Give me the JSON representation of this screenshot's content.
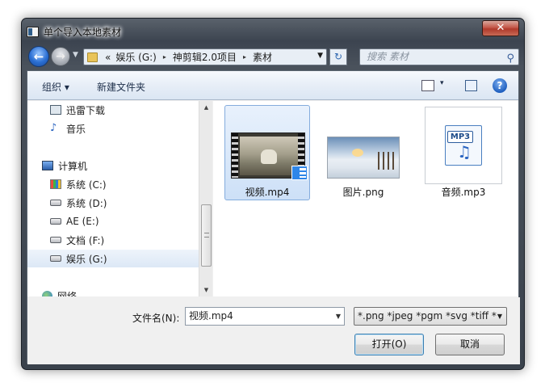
{
  "window": {
    "title": "单个导入本地素材",
    "close_label": "✕"
  },
  "address": {
    "overflow": "«",
    "breadcrumbs": [
      "娱乐 (G:)",
      "神剪辑2.0项目",
      "素材"
    ],
    "separator": "▸",
    "search_placeholder": "搜索 素材"
  },
  "toolbar": {
    "organize": "组织 ▾",
    "new_folder": "新建文件夹",
    "view_dropdown": "▾",
    "help": "?"
  },
  "nav": {
    "items": [
      {
        "label": "迅雷下载",
        "icon": "download-folder-icon"
      },
      {
        "label": "音乐",
        "icon": "music-icon"
      },
      {
        "label": "计算机",
        "icon": "computer-icon"
      },
      {
        "label": "系统 (C:)",
        "icon": "system-drive-icon"
      },
      {
        "label": "系统 (D:)",
        "icon": "drive-icon"
      },
      {
        "label": "AE (E:)",
        "icon": "drive-icon"
      },
      {
        "label": "文档 (F:)",
        "icon": "drive-icon"
      },
      {
        "label": "娱乐 (G:)",
        "icon": "drive-icon",
        "selected": true
      },
      {
        "label": "网络",
        "icon": "network-icon"
      }
    ]
  },
  "files": [
    {
      "name": "视频.mp4",
      "type": "video",
      "selected": true
    },
    {
      "name": "图片.png",
      "type": "image"
    },
    {
      "name": "音频.mp3",
      "type": "audio",
      "badge": "MP3",
      "note": "♫"
    }
  ],
  "footer": {
    "filename_label": "文件名(N):",
    "filename_value": "视频.mp4",
    "filetype_value": "*.png *jpeg *pgm *svg *tiff *",
    "open_button": "打开(O)",
    "cancel_button": "取消"
  }
}
